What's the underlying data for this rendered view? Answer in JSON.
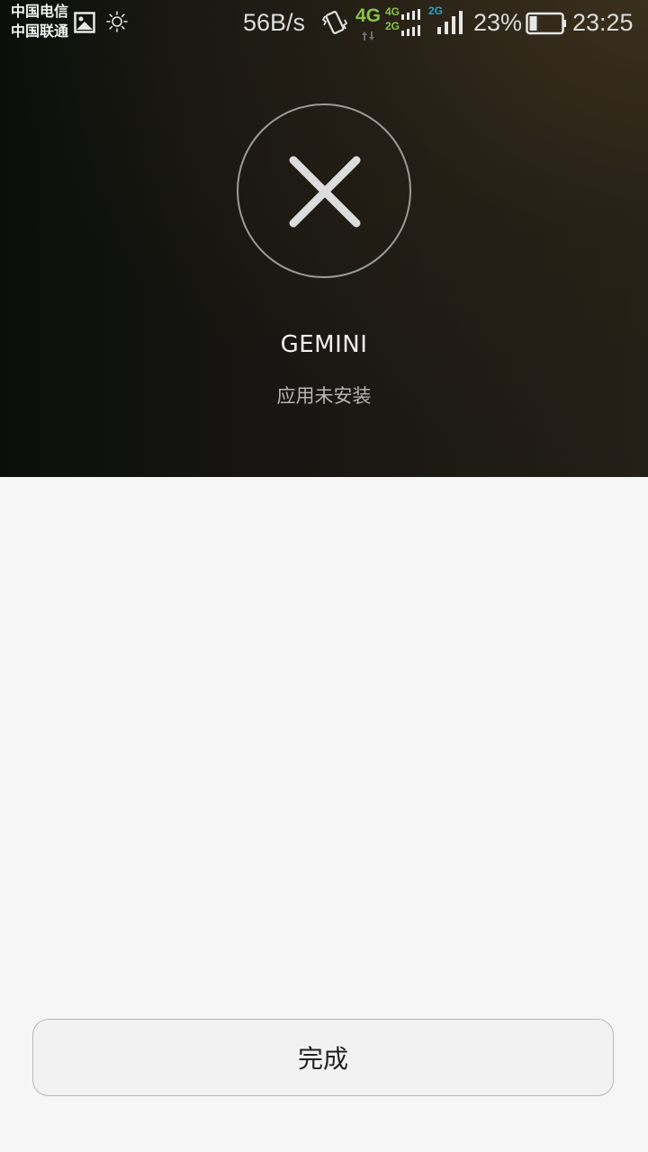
{
  "status_bar": {
    "carrier_1": "中国电信",
    "carrier_2": "中国联通",
    "net_speed": "56B/s",
    "net_type_main": "4G",
    "sim1_label_top": "4G",
    "sim1_label_bottom": "2G",
    "sim2_label": "2G",
    "battery_percent": "23%",
    "battery_level": 0.23,
    "time": "23:25",
    "icons": [
      "gallery-icon",
      "brightness-icon",
      "vibrate-icon",
      "signal-icon",
      "signal-icon",
      "battery-icon"
    ],
    "accent_green": "#8bc34a",
    "accent_blue": "#26a6c9"
  },
  "result": {
    "icon": "close-icon",
    "app_name": "GEMINI",
    "status_text": "应用未安装"
  },
  "actions": {
    "done_label": "完成"
  }
}
